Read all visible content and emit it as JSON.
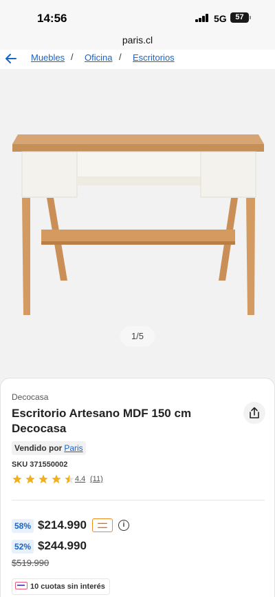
{
  "status_bar": {
    "time": "14:56",
    "network": "5G",
    "battery": "57"
  },
  "browser": {
    "url": "paris.cl"
  },
  "breadcrumb": {
    "items": [
      "Muebles",
      "Oficina",
      "Escritorios"
    ],
    "separator": "/"
  },
  "gallery": {
    "pager": "1/5"
  },
  "product": {
    "brand": "Decocasa",
    "title": "Escritorio Artesano MDF 150 cm Decocasa",
    "seller_prefix": "Vendido por",
    "seller_name": "Paris",
    "sku": "SKU 371550002",
    "rating": "4.4",
    "rating_value": 4.4,
    "reviews": "(11)",
    "prices": [
      {
        "discount": "58%",
        "price": "$214.990",
        "badge": "cashback"
      },
      {
        "discount": "52%",
        "price": "$244.990"
      }
    ],
    "old_price": "$519.990",
    "installments": "10 cuotas sin interés"
  },
  "colors": {
    "link": "#1a63c7",
    "star": "#f2b01e",
    "discount_bg": "#e7f0fb"
  }
}
